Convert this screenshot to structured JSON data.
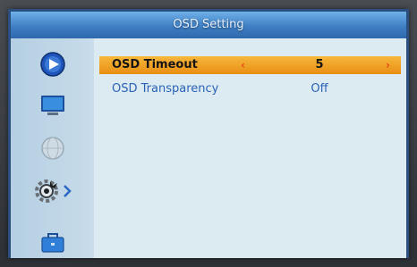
{
  "window": {
    "title": "OSD Setting"
  },
  "sidebar": {
    "items": [
      {
        "icon": "play-icon"
      },
      {
        "icon": "tv-screen-icon"
      },
      {
        "icon": "globe-icon"
      },
      {
        "icon": "gear-icon"
      },
      {
        "icon": "briefcase-icon"
      }
    ]
  },
  "settings": [
    {
      "label": "OSD Timeout",
      "value": "5",
      "left_arrow": "‹",
      "right_arrow": "›"
    },
    {
      "label": "OSD Transparency",
      "value": "Off"
    }
  ],
  "colors": {
    "title_bar": "#3f7fc4",
    "selected_row": "#f0a32a",
    "label_text": "#2a62b8",
    "arrow": "#e8481a"
  }
}
